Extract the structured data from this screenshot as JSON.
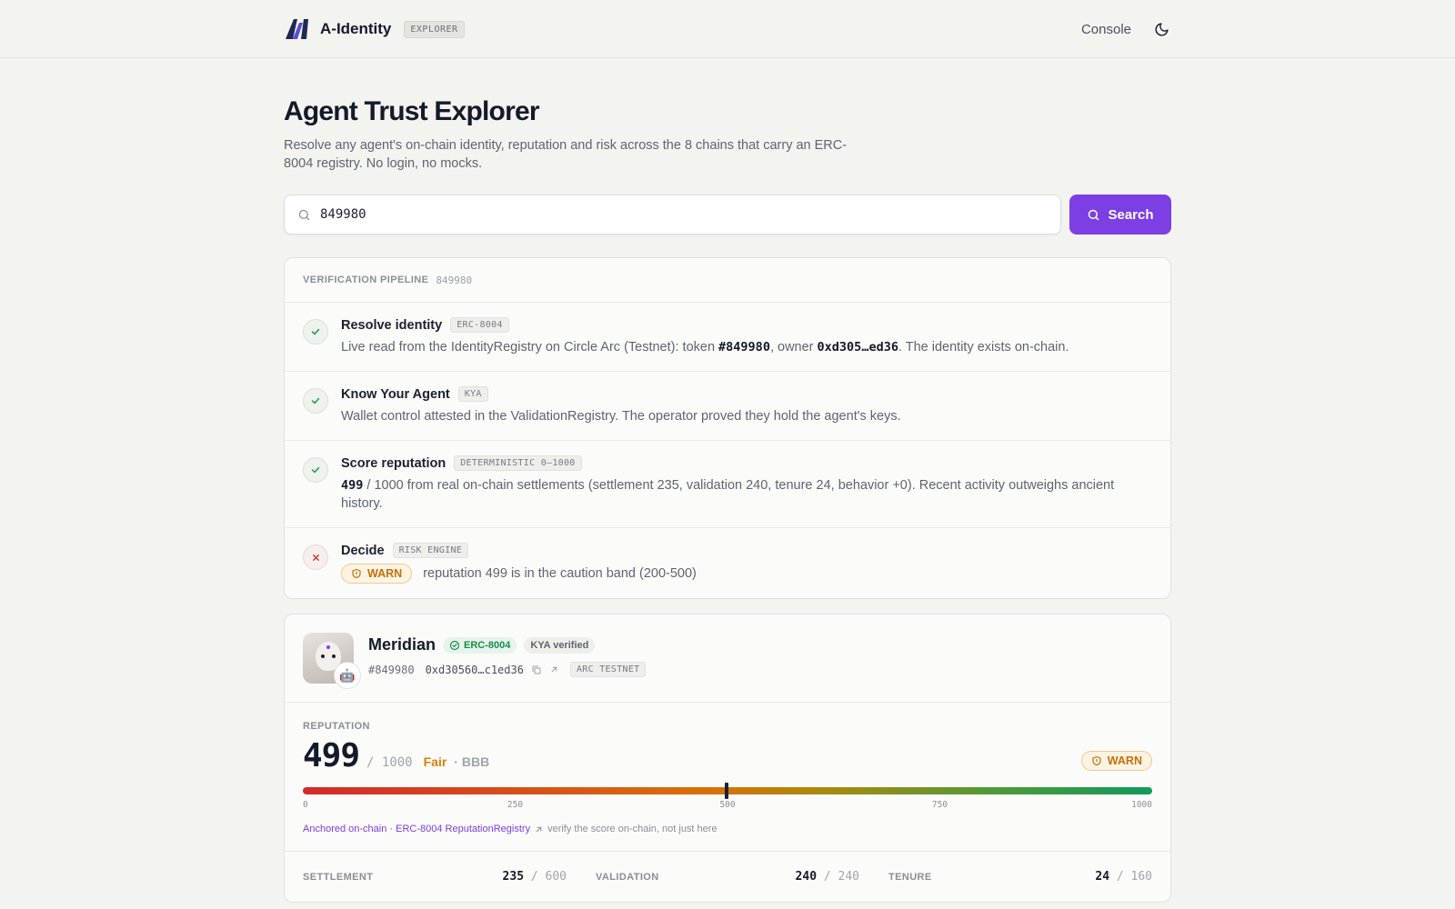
{
  "header": {
    "brand": "A-Identity",
    "tag": "EXPLORER",
    "console": "Console"
  },
  "hero": {
    "title": "Agent Trust Explorer",
    "subtitle": "Resolve any agent's on-chain identity, reputation and risk across the 8 chains that carry an ERC-8004 registry. No login, no mocks."
  },
  "search": {
    "value": "849980",
    "button": "Search"
  },
  "pipeline": {
    "label": "VERIFICATION PIPELINE",
    "id": "849980",
    "steps": [
      {
        "title": "Resolve identity",
        "chip": "ERC-8004",
        "status": "ok",
        "desc_prefix": "Live read from the IdentityRegistry on Circle Arc (Testnet): token ",
        "token": "#849980",
        "desc_mid": ", owner ",
        "owner": "0xd305…ed36",
        "desc_suffix": ". The identity exists on-chain."
      },
      {
        "title": "Know Your Agent",
        "chip": "KYA",
        "status": "ok",
        "desc": "Wallet control attested in the ValidationRegistry. The operator proved they hold the agent's keys."
      },
      {
        "title": "Score reputation",
        "chip": "DETERMINISTIC 0–1000",
        "status": "ok",
        "score": "499",
        "desc": " / 1000 from real on-chain settlements (settlement 235, validation 240, tenure 24, behavior +0). Recent activity outweighs ancient history."
      },
      {
        "title": "Decide",
        "chip": "RISK ENGINE",
        "status": "fail",
        "verdict": "WARN",
        "reason": "reputation 499 is in the caution band (200-500)"
      }
    ]
  },
  "agent": {
    "name": "Meridian",
    "erc_badge": "ERC-8004",
    "kya_badge": "KYA verified",
    "token": "#849980",
    "address": "0xd30560…c1ed36",
    "chain": "ARC TESTNET"
  },
  "reputation": {
    "label": "REPUTATION",
    "score": 499,
    "score_text": "499",
    "max": "/ 1000",
    "grade": "Fair",
    "rating": "· BBB",
    "verdict": "WARN",
    "gauge_min": 0,
    "gauge_max": 1000,
    "ticks": [
      "0",
      "250",
      "500",
      "750",
      "1000"
    ],
    "anchored_link": "Anchored on-chain · ERC-8004 ReputationRegistry",
    "anchored_note": "verify the score on-chain, not just here"
  },
  "breakdown": [
    {
      "label": "SETTLEMENT",
      "value": "235",
      "sep": "/",
      "max": "600"
    },
    {
      "label": "VALIDATION",
      "value": "240",
      "sep": "/",
      "max": "240"
    },
    {
      "label": "TENURE",
      "value": "24",
      "sep": "/",
      "max": "160"
    }
  ],
  "colors": {
    "accent": "#7b3fe4",
    "ok": "#1f9a4c",
    "fail": "#d23232",
    "warn": "#c4720c"
  }
}
